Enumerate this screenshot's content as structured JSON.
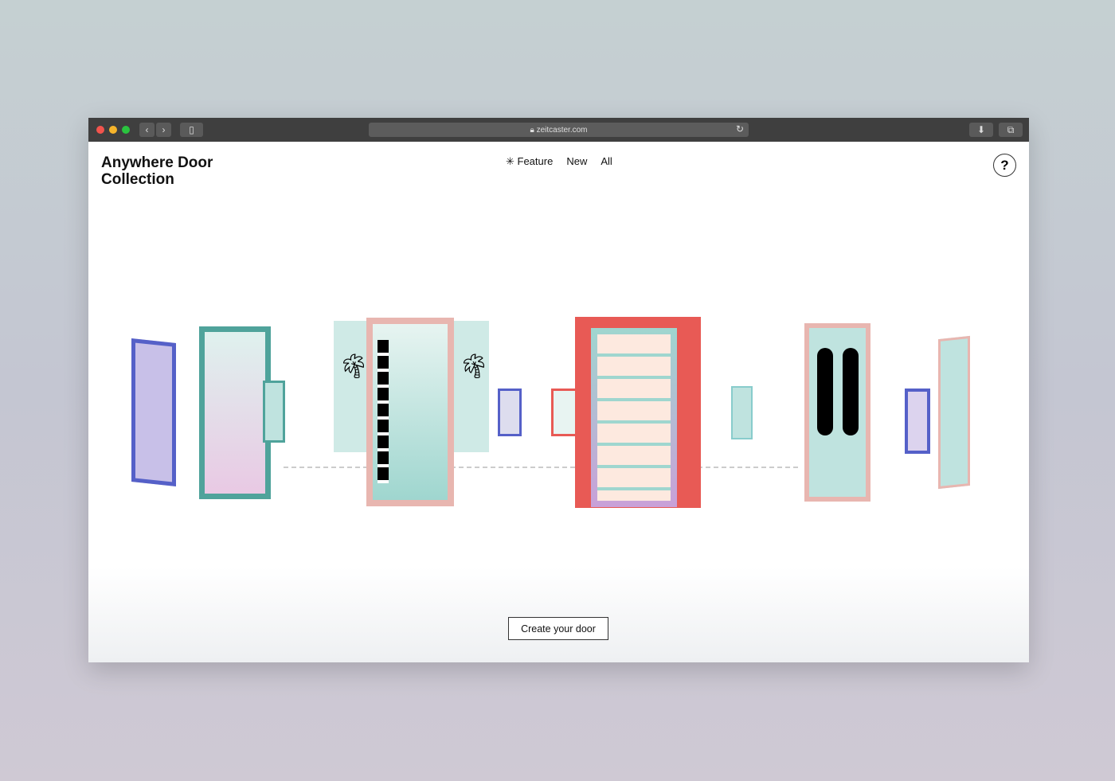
{
  "browser": {
    "url": "zeitcaster.com",
    "icons": [
      "close",
      "minimize",
      "zoom",
      "back",
      "forward",
      "sidebar",
      "lock",
      "reload",
      "download",
      "tabs"
    ]
  },
  "site": {
    "title_line1": "Anywhere Door",
    "title_line2": "Collection"
  },
  "nav": {
    "feature_icon": "asterisk-icon",
    "items": [
      {
        "label": "Feature"
      },
      {
        "label": "New"
      },
      {
        "label": "All"
      }
    ]
  },
  "help": {
    "label": "?"
  },
  "cta": {
    "label": "Create your door"
  },
  "colors": {
    "teal": "#9fd6cf",
    "red": "#e85a55",
    "pink": "#e8b6b0",
    "blue": "#5560c8",
    "frame_teal": "#4fa39b"
  }
}
